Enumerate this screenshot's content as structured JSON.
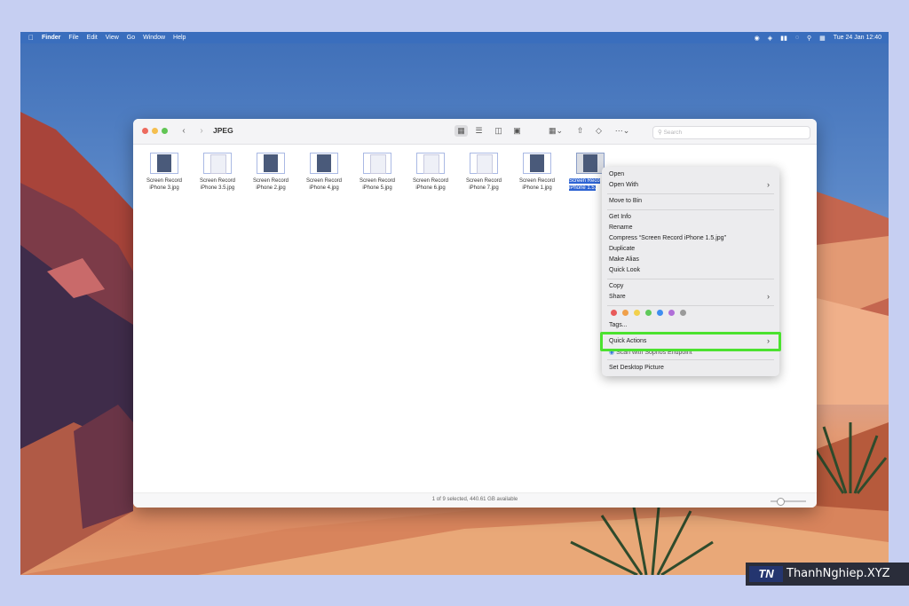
{
  "menubar": {
    "apple": "",
    "app": "Finder",
    "menus": [
      "File",
      "Edit",
      "View",
      "Go",
      "Window",
      "Help"
    ],
    "datetime": "Tue 24 Jan  12:40"
  },
  "finder": {
    "title": "JPEG",
    "search_placeholder": "Search",
    "files": [
      {
        "line1": "Screen Record",
        "line2": "iPhone 3.jpg"
      },
      {
        "line1": "Screen Record",
        "line2": "iPhone 3.5.jpg"
      },
      {
        "line1": "Screen Record",
        "line2": "iPhone 2.jpg"
      },
      {
        "line1": "Screen Record",
        "line2": "iPhone 4.jpg"
      },
      {
        "line1": "Screen Record",
        "line2": "iPhone 5.jpg"
      },
      {
        "line1": "Screen Record",
        "line2": "iPhone 6.jpg"
      },
      {
        "line1": "Screen Record",
        "line2": "iPhone 7.jpg"
      },
      {
        "line1": "Screen Record",
        "line2": "iPhone 1.jpg"
      },
      {
        "line1": "Screen Reco",
        "line2": "iPhone 1.5."
      }
    ],
    "status": "1 of 9 selected, 440.61 GB available",
    "zoom_level": 0.2
  },
  "context_menu": {
    "items": [
      {
        "label": "Open"
      },
      {
        "label": "Open With"
      },
      {
        "label": "Move to Bin"
      },
      {
        "label": "Get Info"
      },
      {
        "label": "Rename"
      },
      {
        "label": "Compress “Screen Record iPhone 1.5.jpg”"
      },
      {
        "label": "Duplicate"
      },
      {
        "label": "Make Alias"
      },
      {
        "label": "Quick Look"
      },
      {
        "label": "Copy"
      },
      {
        "label": "Share"
      },
      {
        "label": "Tags..."
      },
      {
        "label": "Quick Actions"
      },
      {
        "label": "Scan with Sophos Endpoint"
      },
      {
        "label": "Set Desktop Picture"
      }
    ],
    "tag_colors": [
      "#e85a5a",
      "#f0a04a",
      "#f2d04c",
      "#5fc95a",
      "#3f8ef0",
      "#b06fd8",
      "#9a9a9a"
    ],
    "highlight_color": "#4be22f"
  },
  "watermark": {
    "logo": "TN",
    "text": "ThanhNghiep.XYZ"
  }
}
